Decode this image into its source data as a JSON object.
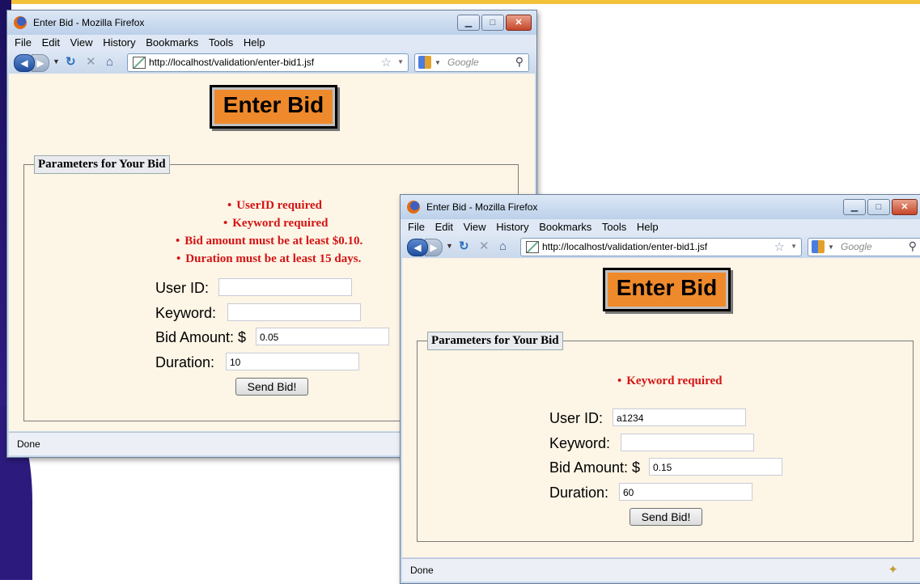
{
  "window1": {
    "title": "Enter Bid - Mozilla Firefox",
    "menu": [
      "File",
      "Edit",
      "View",
      "History",
      "Bookmarks",
      "Tools",
      "Help"
    ],
    "url": "http://localhost/validation/enter-bid1.jsf",
    "search_placeholder": "Google",
    "heading": "Enter Bid",
    "fieldset_legend": "Parameters for Your Bid",
    "errors": [
      "UserID required",
      "Keyword required",
      "Bid amount must be at least $0.10.",
      "Duration must be at least 15 days."
    ],
    "labels": {
      "user_id": "User ID:",
      "keyword": "Keyword:",
      "bid_amount": "Bid Amount: $",
      "duration": "Duration:"
    },
    "values": {
      "user_id": "",
      "keyword": "",
      "bid_amount": "0.05",
      "duration": "10"
    },
    "submit_label": "Send Bid!",
    "status": "Done"
  },
  "window2": {
    "title": "Enter Bid - Mozilla Firefox",
    "menu": [
      "File",
      "Edit",
      "View",
      "History",
      "Bookmarks",
      "Tools",
      "Help"
    ],
    "url": "http://localhost/validation/enter-bid1.jsf",
    "search_placeholder": "Google",
    "heading": "Enter Bid",
    "fieldset_legend": "Parameters for Your Bid",
    "errors": [
      "Keyword required"
    ],
    "labels": {
      "user_id": "User ID:",
      "keyword": "Keyword:",
      "bid_amount": "Bid Amount: $",
      "duration": "Duration:"
    },
    "values": {
      "user_id": "a1234",
      "keyword": "",
      "bid_amount": "0.15",
      "duration": "60"
    },
    "submit_label": "Send Bid!",
    "status": "Done"
  },
  "icons": [
    "firefox-icon",
    "minimize-icon",
    "maximize-icon",
    "close-icon",
    "back-icon",
    "forward-icon",
    "reload-icon",
    "stop-icon",
    "home-icon",
    "site-icon",
    "bookmark-star-icon",
    "google-icon",
    "search-icon",
    "addon-icon"
  ],
  "colors": {
    "heading_bg": "#ef8a2c",
    "error": "#d31414",
    "page_bg": "#fdf5e6",
    "slide_accent": "#f3c23a",
    "slide_band": "#2a1a7a"
  }
}
